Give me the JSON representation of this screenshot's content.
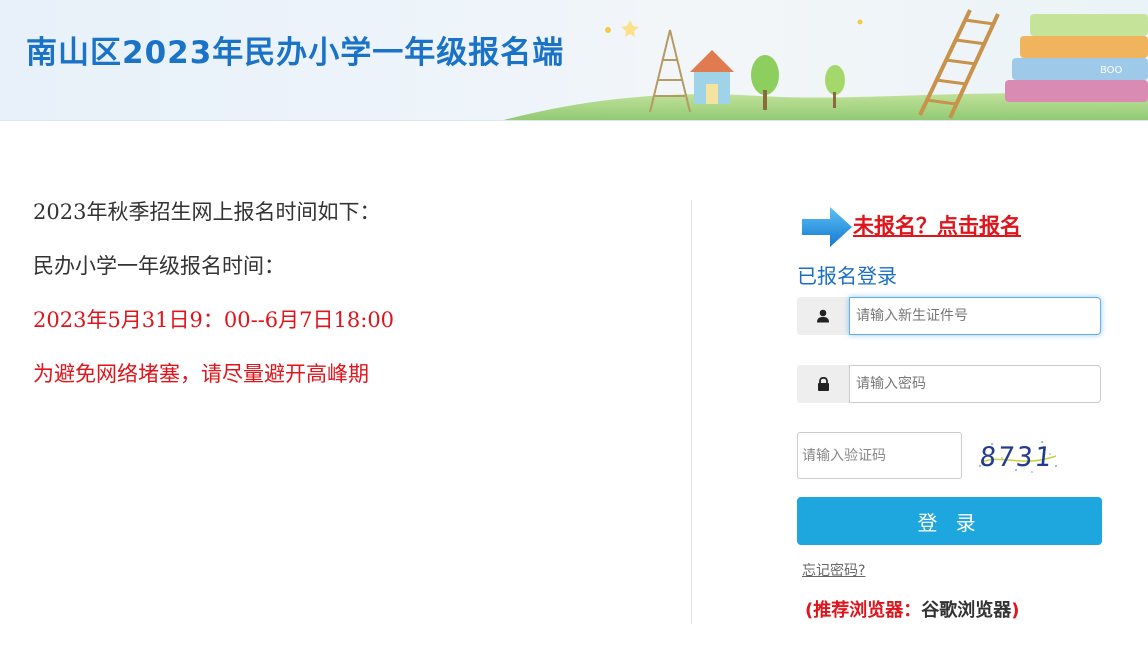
{
  "header": {
    "title": "南山区2023年民办小学一年级报名端",
    "colors": {
      "title": "#1a73c7",
      "background": "#eaf2f9"
    }
  },
  "notice": {
    "lines": [
      {
        "text": "2023年秋季招生网上报名时间如下：",
        "color": "#333333"
      },
      {
        "text": "民办小学一年级报名时间：",
        "color": "#333333"
      },
      {
        "text": "2023年5月31日9：00--6月7日18:00",
        "color": "#e0141b"
      },
      {
        "text": "为避免网络堵塞，请尽量避开高峰期",
        "color": "#e0141b"
      }
    ]
  },
  "login": {
    "register_link": "未报名？点击报名",
    "heading": "已报名登录",
    "id_field": {
      "placeholder": "请输入新生证件号",
      "value": "",
      "icon": "user-icon"
    },
    "password_field": {
      "placeholder": "请输入密码",
      "value": "",
      "icon": "lock-icon"
    },
    "captcha_field": {
      "placeholder": "请输入验证码",
      "value": ""
    },
    "captcha_text": "8731",
    "login_button": "登 录",
    "forgot_password": "忘记密码?",
    "browser_tip": {
      "open": "(",
      "label": "推荐浏览器：",
      "value": "谷歌浏览器",
      "close": ")"
    },
    "colors": {
      "accent": "#1ea6de",
      "link_red": "#e0141b",
      "heading": "#1a6fc4"
    }
  }
}
